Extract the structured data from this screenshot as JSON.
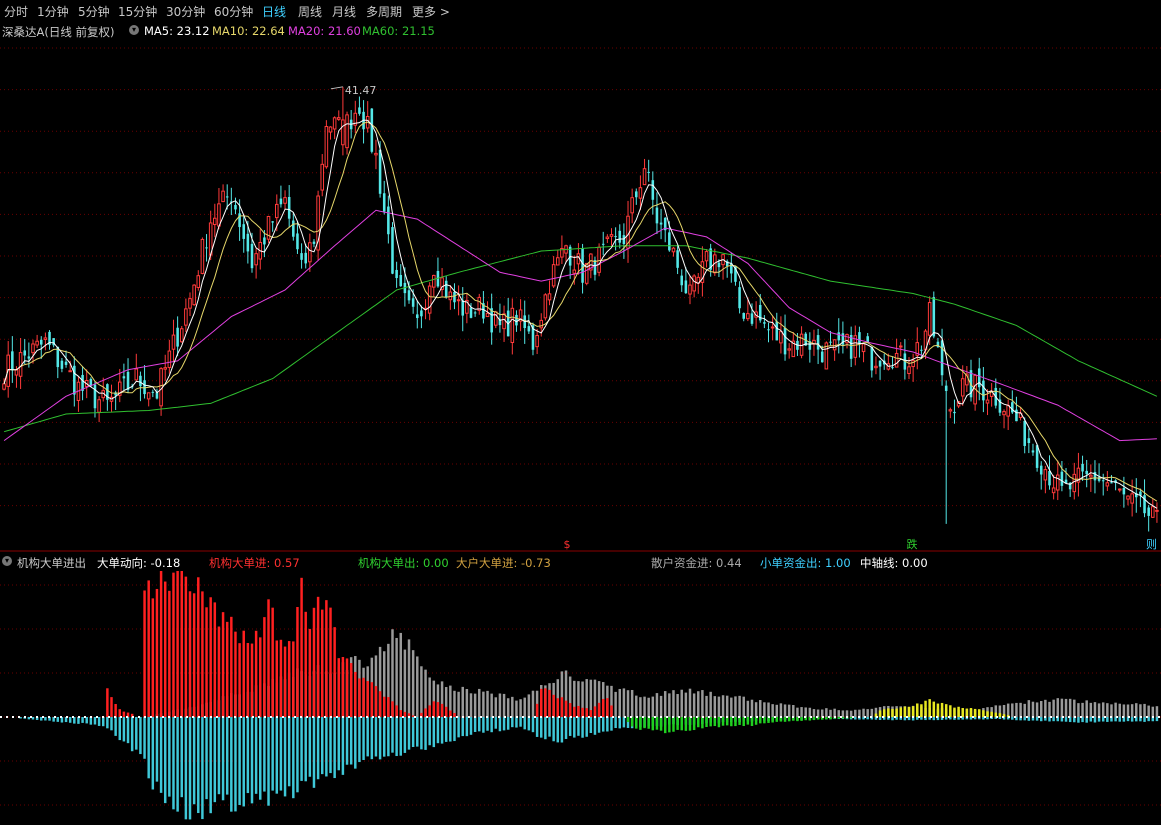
{
  "toolbar": {
    "items": [
      {
        "label": "分时",
        "active": false
      },
      {
        "label": "1分钟",
        "active": false
      },
      {
        "label": "5分钟",
        "active": false
      },
      {
        "label": "15分钟",
        "active": false
      },
      {
        "label": "30分钟",
        "active": false
      },
      {
        "label": "60分钟",
        "active": false
      },
      {
        "label": "日线",
        "active": true
      },
      {
        "label": "周线",
        "active": false
      },
      {
        "label": "月线",
        "active": false
      },
      {
        "label": "多周期",
        "active": false
      },
      {
        "label": "更多 >",
        "active": false
      }
    ]
  },
  "main_legend": {
    "stock": "深桑达A(日线 前复权)",
    "ma5": "MA5: 23.12",
    "ma10": "MA10: 22.64",
    "ma20": "MA20: 21.60",
    "ma60": "MA60: 21.15",
    "peak_label": "41.47",
    "markers": [
      {
        "label": "$",
        "color": "#ff3030"
      },
      {
        "label": "跌",
        "color": "#30d030"
      },
      {
        "label": "则",
        "color": "#3fd0ff"
      }
    ]
  },
  "indicator_legend": {
    "name": "机构大单进出",
    "items": [
      {
        "label": "大单动向: -0.18",
        "color": "#ffffff"
      },
      {
        "label": "机构大单进: 0.57",
        "color": "#ff3030"
      },
      {
        "label": "机构大单出: 0.00",
        "color": "#30d030"
      },
      {
        "label": "大户大单进: -0.73",
        "color": "#d0a040"
      },
      {
        "label": "散户资金进: 0.44",
        "color": "#aaaaaa"
      },
      {
        "label": "小单资金出: 1.00",
        "color": "#3fd0ff"
      },
      {
        "label": "中轴线: 0.00",
        "color": "#ffffff"
      }
    ]
  },
  "colors": {
    "up": "#ff3a3a",
    "down": "#54e8e8",
    "ma5": "#ffffff",
    "ma10": "#e6d76a",
    "ma20": "#e040e0",
    "ma60": "#30c030",
    "grid": "#6a0000",
    "inst_in": "#ff2020",
    "inst_out": "#20d020",
    "big_in_yellow": "#e8e820",
    "retail_in": "#9a9a9a",
    "small_out": "#3fc8d8"
  },
  "chart_data": [
    {
      "type": "candlestick",
      "title": "深桑达A(日线 前复权)",
      "ylim": [
        16,
        44
      ],
      "peak": 41.47,
      "ma_last": {
        "MA5": 23.12,
        "MA10": 22.64,
        "MA20": 21.6,
        "MA60": 21.15
      },
      "close_keypoints": [
        [
          0,
          25.5
        ],
        [
          10,
          27.0
        ],
        [
          18,
          24.5
        ],
        [
          25,
          23.5
        ],
        [
          32,
          25.0
        ],
        [
          37,
          24.2
        ],
        [
          45,
          29.5
        ],
        [
          50,
          34.0
        ],
        [
          55,
          35.5
        ],
        [
          60,
          31.5
        ],
        [
          64,
          33.5
        ],
        [
          68,
          35.0
        ],
        [
          72,
          31.0
        ],
        [
          75,
          33.0
        ],
        [
          78,
          39.5
        ],
        [
          82,
          39.0
        ],
        [
          86,
          40.5
        ],
        [
          90,
          37.5
        ],
        [
          95,
          30.0
        ],
        [
          100,
          28.0
        ],
        [
          104,
          31.5
        ],
        [
          108,
          29.5
        ],
        [
          112,
          28.8
        ],
        [
          116,
          29.0
        ],
        [
          120,
          27.8
        ],
        [
          124,
          28.5
        ],
        [
          128,
          27.0
        ],
        [
          132,
          30.5
        ],
        [
          136,
          32.5
        ],
        [
          140,
          31.0
        ],
        [
          145,
          32.0
        ],
        [
          150,
          33.0
        ],
        [
          155,
          37.0
        ],
        [
          158,
          34.0
        ],
        [
          162,
          32.0
        ],
        [
          166,
          29.5
        ],
        [
          170,
          31.5
        ],
        [
          174,
          32.0
        ],
        [
          178,
          29.0
        ],
        [
          182,
          28.5
        ],
        [
          186,
          27.5
        ],
        [
          190,
          27.0
        ],
        [
          194,
          27.2
        ],
        [
          198,
          26.6
        ],
        [
          202,
          26.5
        ],
        [
          206,
          27.0
        ],
        [
          210,
          26.2
        ],
        [
          214,
          26.5
        ],
        [
          218,
          26.0
        ],
        [
          222,
          27.0
        ],
        [
          224,
          28.5
        ],
        [
          226,
          26.5
        ],
        [
          228,
          23.0
        ],
        [
          232,
          24.5
        ],
        [
          236,
          24.5
        ],
        [
          240,
          24.0
        ],
        [
          244,
          23.0
        ],
        [
          248,
          21.5
        ],
        [
          252,
          20.0
        ],
        [
          256,
          18.5
        ],
        [
          260,
          19.2
        ],
        [
          264,
          19.5
        ],
        [
          268,
          19.0
        ],
        [
          272,
          18.0
        ],
        [
          276,
          17.5
        ],
        [
          279,
          16.8
        ]
      ],
      "ma60_keypoints": [
        [
          0,
          22.0
        ],
        [
          15,
          23.0
        ],
        [
          35,
          23.2
        ],
        [
          50,
          23.6
        ],
        [
          65,
          25.0
        ],
        [
          80,
          27.5
        ],
        [
          95,
          30.0
        ],
        [
          110,
          31.0
        ],
        [
          130,
          32.2
        ],
        [
          150,
          32.5
        ],
        [
          165,
          32.5
        ],
        [
          180,
          31.8
        ],
        [
          200,
          30.5
        ],
        [
          220,
          29.8
        ],
        [
          230,
          29.2
        ],
        [
          245,
          28.0
        ],
        [
          260,
          26.0
        ],
        [
          279,
          24.0
        ]
      ],
      "ma20_keypoints": [
        [
          0,
          21.5
        ],
        [
          15,
          24.0
        ],
        [
          30,
          25.5
        ],
        [
          42,
          26.0
        ],
        [
          55,
          28.5
        ],
        [
          68,
          30.0
        ],
        [
          80,
          32.5
        ],
        [
          90,
          34.5
        ],
        [
          100,
          34.0
        ],
        [
          110,
          32.5
        ],
        [
          120,
          31.0
        ],
        [
          130,
          30.5
        ],
        [
          140,
          31.0
        ],
        [
          150,
          32.2
        ],
        [
          160,
          33.5
        ],
        [
          170,
          33.0
        ],
        [
          180,
          31.5
        ],
        [
          190,
          29.0
        ],
        [
          200,
          27.6
        ],
        [
          210,
          27.0
        ],
        [
          220,
          26.5
        ],
        [
          228,
          25.8
        ],
        [
          240,
          24.8
        ],
        [
          255,
          23.5
        ],
        [
          270,
          21.5
        ],
        [
          279,
          21.6
        ]
      ]
    },
    {
      "type": "bar",
      "title": "机构大单进出",
      "ylim": [
        -1,
        1
      ],
      "series": [
        {
          "name": "机构大单进",
          "keypoints": [
            [
              0,
              0
            ],
            [
              24,
              0
            ],
            [
              25,
              0.18
            ],
            [
              28,
              0.05
            ],
            [
              33,
              0
            ],
            [
              34,
              1.0
            ],
            [
              37,
              0.92
            ],
            [
              40,
              1.0
            ],
            [
              44,
              0.95
            ],
            [
              48,
              0.85
            ],
            [
              52,
              0.7
            ],
            [
              56,
              0.6
            ],
            [
              60,
              0.55
            ],
            [
              62,
              0.62
            ],
            [
              64,
              0.9
            ],
            [
              66,
              0.55
            ],
            [
              70,
              0.48
            ],
            [
              72,
              0.9
            ],
            [
              74,
              0.65
            ],
            [
              78,
              0.85
            ],
            [
              81,
              0.45
            ],
            [
              86,
              0.3
            ],
            [
              92,
              0.15
            ],
            [
              96,
              0.05
            ],
            [
              100,
              0
            ],
            [
              104,
              0.12
            ],
            [
              108,
              0.05
            ],
            [
              110,
              0
            ],
            [
              128,
              0
            ],
            [
              130,
              0.2
            ],
            [
              134,
              0.15
            ],
            [
              138,
              0.08
            ],
            [
              142,
              0.05
            ],
            [
              146,
              0.15
            ],
            [
              148,
              0
            ],
            [
              279,
              0
            ]
          ]
        },
        {
          "name": "机构大单出",
          "keypoints": [
            [
              0,
              0
            ],
            [
              150,
              0
            ],
            [
              152,
              0.1
            ],
            [
              160,
              0.14
            ],
            [
              170,
              0.1
            ],
            [
              180,
              0.08
            ],
            [
              190,
              0.04
            ],
            [
              200,
              0.02
            ],
            [
              210,
              0
            ],
            [
              279,
              0
            ]
          ]
        },
        {
          "name": "大户大单进",
          "keypoints": [
            [
              0,
              0
            ],
            [
              210,
              0
            ],
            [
              212,
              0.05
            ],
            [
              220,
              0.08
            ],
            [
              224,
              0.12
            ],
            [
              228,
              0.08
            ],
            [
              234,
              0.06
            ],
            [
              240,
              0.03
            ],
            [
              245,
              0
            ],
            [
              279,
              0
            ]
          ]
        },
        {
          "name": "散户资金进",
          "keypoints": [
            [
              0,
              0
            ],
            [
              34,
              0.0
            ],
            [
              50,
              0.1
            ],
            [
              60,
              0.2
            ],
            [
              70,
              0.3
            ],
            [
              80,
              0.35
            ],
            [
              88,
              0.4
            ],
            [
              94,
              0.55
            ],
            [
              98,
              0.5
            ],
            [
              102,
              0.3
            ],
            [
              108,
              0.2
            ],
            [
              115,
              0.18
            ],
            [
              125,
              0.12
            ],
            [
              135,
              0.3
            ],
            [
              145,
              0.22
            ],
            [
              155,
              0.15
            ],
            [
              165,
              0.18
            ],
            [
              175,
              0.15
            ],
            [
              185,
              0.1
            ],
            [
              195,
              0.06
            ],
            [
              205,
              0.05
            ],
            [
              215,
              0.08
            ],
            [
              225,
              0.06
            ],
            [
              235,
              0.05
            ],
            [
              245,
              0.1
            ],
            [
              255,
              0.12
            ],
            [
              265,
              0.1
            ],
            [
              279,
              0.08
            ]
          ]
        },
        {
          "name": "小单资金出",
          "keypoints": [
            [
              0,
              0
            ],
            [
              24,
              -0.08
            ],
            [
              28,
              -0.2
            ],
            [
              33,
              -0.35
            ],
            [
              36,
              -0.65
            ],
            [
              40,
              -0.8
            ],
            [
              45,
              -0.9
            ],
            [
              50,
              -0.85
            ],
            [
              55,
              -0.8
            ],
            [
              60,
              -0.78
            ],
            [
              65,
              -0.75
            ],
            [
              70,
              -0.7
            ],
            [
              75,
              -0.6
            ],
            [
              80,
              -0.55
            ],
            [
              85,
              -0.45
            ],
            [
              90,
              -0.4
            ],
            [
              95,
              -0.35
            ],
            [
              100,
              -0.3
            ],
            [
              105,
              -0.25
            ],
            [
              110,
              -0.2
            ],
            [
              115,
              -0.15
            ],
            [
              120,
              -0.12
            ],
            [
              125,
              -0.1
            ],
            [
              130,
              -0.2
            ],
            [
              135,
              -0.22
            ],
            [
              140,
              -0.18
            ],
            [
              145,
              -0.14
            ],
            [
              150,
              -0.1
            ],
            [
              160,
              -0.08
            ],
            [
              170,
              -0.06
            ],
            [
              180,
              -0.04
            ],
            [
              190,
              -0.03
            ],
            [
              200,
              -0.02
            ],
            [
              220,
              -0.03
            ],
            [
              240,
              -0.02
            ],
            [
              260,
              -0.05
            ],
            [
              279,
              -0.04
            ]
          ]
        }
      ]
    }
  ]
}
